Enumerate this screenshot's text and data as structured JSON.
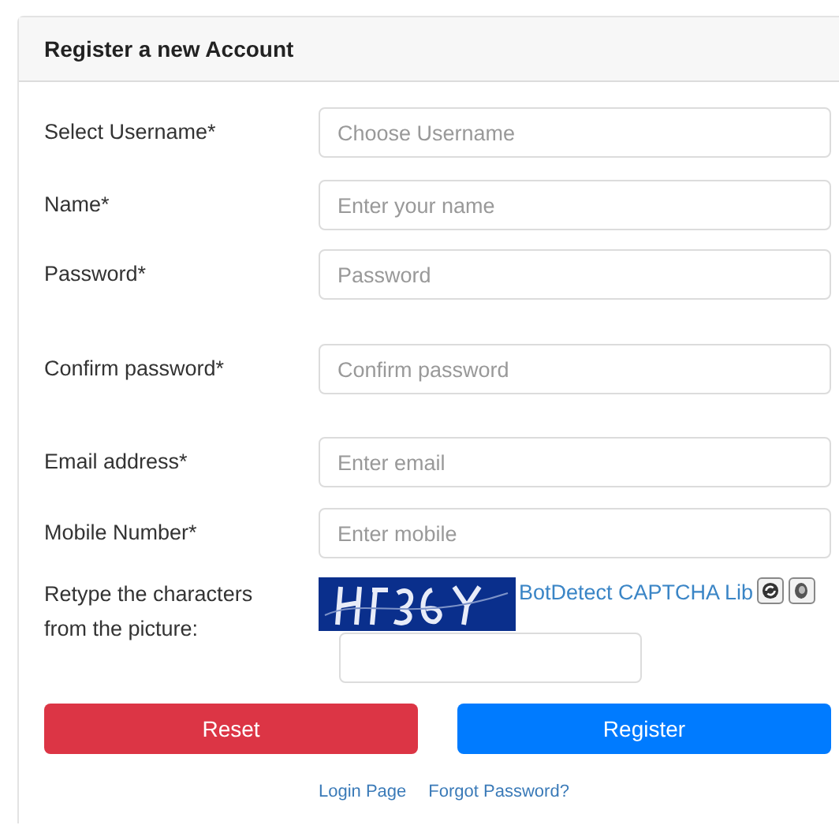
{
  "card": {
    "title": "Register a new Account"
  },
  "fields": [
    {
      "label": "Select Username*",
      "placeholder": "Choose Username"
    },
    {
      "label": "Name*",
      "placeholder": "Enter your name"
    },
    {
      "label": "Password*",
      "placeholder": "Password"
    },
    {
      "label": "Confirm password*",
      "placeholder": "Confirm password"
    },
    {
      "label": "Email address*",
      "placeholder": "Enter email"
    },
    {
      "label": "Mobile Number*",
      "placeholder": "Enter mobile"
    }
  ],
  "captcha": {
    "label": "Retype the characters from the picture:",
    "link": "BotDetect CAPTCHA Lib"
  },
  "buttons": [
    {
      "label": "Reset",
      "kind": "danger"
    },
    {
      "label": "Register",
      "kind": "primary"
    }
  ],
  "links": [
    "Login Page",
    "Forgot Password?"
  ]
}
